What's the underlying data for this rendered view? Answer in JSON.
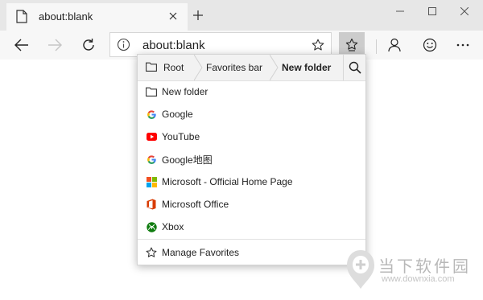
{
  "tab": {
    "title": "about:blank"
  },
  "address": {
    "url": "about:blank"
  },
  "favorites": {
    "breadcrumbs": [
      "Root",
      "Favorites bar",
      "New folder"
    ],
    "items": [
      {
        "label": "New folder",
        "icon": "folder-icon"
      },
      {
        "label": "Google",
        "icon": "google-icon"
      },
      {
        "label": "YouTube",
        "icon": "youtube-icon"
      },
      {
        "label": "Google地图",
        "icon": "google-icon"
      },
      {
        "label": "Microsoft - Official Home Page",
        "icon": "microsoft-icon"
      },
      {
        "label": "Microsoft Office",
        "icon": "office-icon"
      },
      {
        "label": "Xbox",
        "icon": "xbox-icon"
      }
    ],
    "manage_label": "Manage Favorites"
  },
  "watermark": {
    "text": "当下软件园",
    "url": "www.downxia.com"
  },
  "colors": {
    "tabstrip": "#e7e7e7",
    "toolbar": "#f7f7f7",
    "hub_active": "#cccccc",
    "youtube_red": "#ff0000",
    "office_orange": "#d83b01",
    "xbox_green": "#107c10"
  }
}
